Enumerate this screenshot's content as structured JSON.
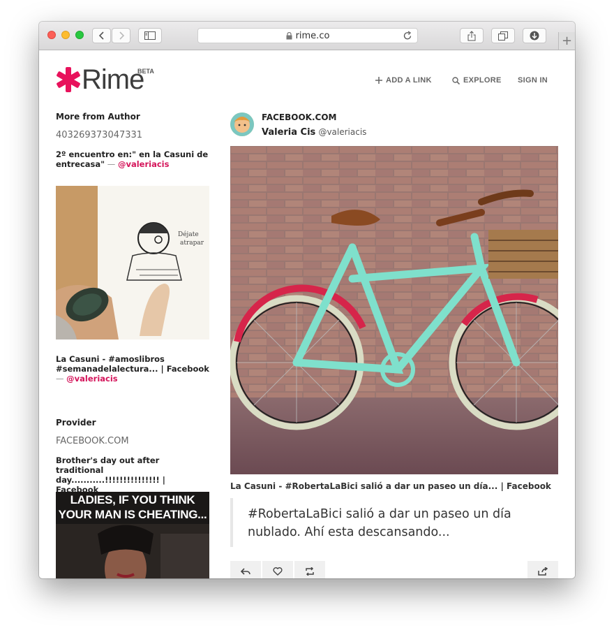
{
  "browser": {
    "url": "rime.co",
    "new_tab": "+"
  },
  "site": {
    "logo_text": "Rime",
    "logo_badge": "BETA",
    "nav": [
      {
        "label": "ADD A LINK",
        "icon": "plus-icon"
      },
      {
        "label": "EXPLORE",
        "icon": "search-icon"
      },
      {
        "label": "SIGN IN",
        "icon": ""
      }
    ],
    "brand_color": "#e8125c"
  },
  "sidebar": {
    "more_heading": "More from Author",
    "author_id": "403269373047331",
    "item1": {
      "title": "2º encuentro en:\" en la Casuni de entrecasa\"",
      "dash": " — ",
      "author": "@valeriacis"
    },
    "item2": {
      "title": "La Casuni - #amoslibros #semanadelalectura... | Facebook",
      "dash": " — ",
      "author": "@valeriacis"
    },
    "provider_heading": "Provider",
    "provider_name": "FACEBOOK.COM",
    "item3": {
      "title": "Brother's day out after traditional day...........!!!!!!!!!!!!!!! | Facebook"
    },
    "meme_text": "LADIES, IF YOU THINK YOUR MAN IS CHEATING..."
  },
  "post": {
    "source": "FACEBOOK.COM",
    "author_name": "Valeria Cis",
    "author_handle": "@valeriacis",
    "caption": "La Casuni - #RobertaLaBici salió a dar un paseo un día... | Facebook",
    "quote": "#RobertaLaBici salió a dar un paseo un día nublado. Ahí esta descansando...",
    "actions": [
      "reply-icon",
      "heart-icon",
      "repost-icon",
      "share-icon"
    ]
  }
}
